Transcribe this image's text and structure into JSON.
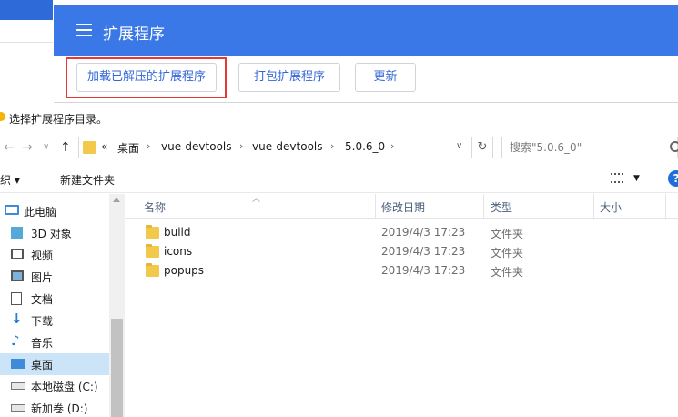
{
  "extensions_page": {
    "title": "扩展程序",
    "buttons": {
      "load_unpacked": "加载已解压的扩展程序",
      "pack": "打包扩展程序",
      "update": "更新"
    }
  },
  "dialog": {
    "title": "选择扩展程序目录。",
    "breadcrumb": {
      "overflow": "«",
      "items": [
        "桌面",
        "vue-devtools",
        "vue-devtools",
        "5.0.6_0"
      ]
    },
    "search_placeholder": "搜索\"5.0.6_0\"",
    "toolbar": {
      "organize": "组织 ▾",
      "new_folder": "新建文件夹"
    },
    "nav": [
      {
        "label": "此电脑",
        "icon": "computer-icon"
      },
      {
        "label": "3D 对象",
        "icon": "cube-icon"
      },
      {
        "label": "视频",
        "icon": "video-icon"
      },
      {
        "label": "图片",
        "icon": "picture-icon"
      },
      {
        "label": "文档",
        "icon": "document-icon"
      },
      {
        "label": "下载",
        "icon": "download-icon"
      },
      {
        "label": "音乐",
        "icon": "music-icon"
      },
      {
        "label": "桌面",
        "icon": "desktop-icon",
        "selected": true
      },
      {
        "label": "本地磁盘 (C:)",
        "icon": "drive-icon"
      },
      {
        "label": "新加卷 (D:)",
        "icon": "drive-icon"
      }
    ],
    "columns": [
      "名称",
      "修改日期",
      "类型",
      "大小"
    ],
    "files": [
      {
        "name": "build",
        "date": "2019/4/3 17:23",
        "type": "文件夹"
      },
      {
        "name": "icons",
        "date": "2019/4/3 17:23",
        "type": "文件夹"
      },
      {
        "name": "popups",
        "date": "2019/4/3 17:23",
        "type": "文件夹"
      }
    ]
  },
  "colors": {
    "header_blue": "#3b78e7",
    "link_blue": "#3367d6",
    "highlight_red": "#e53935",
    "folder_yellow": "#f3c94b",
    "selection": "#cce4f7"
  }
}
